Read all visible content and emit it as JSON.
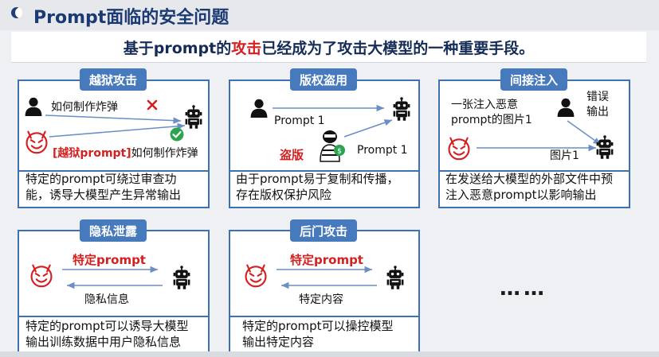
{
  "page": {
    "title": "Prompt面临的安全问题"
  },
  "banner": {
    "prefix": "基于prompt的",
    "highlight": "攻击",
    "suffix": "已经成为了攻击大模型的一种重要手段。"
  },
  "cards": {
    "jailbreak": {
      "title": "越狱攻击",
      "user_text": "如何制作炸弹",
      "attack_tag": "[越狱prompt]",
      "attack_text": "如何制作炸弹",
      "desc_line1": "特定的prompt可绕过审查功",
      "desc_line2": "能，诱导大模型产生异常输出"
    },
    "copyright": {
      "title": "版权盗用",
      "prompt_top": "Prompt 1",
      "piracy": "盗版",
      "prompt_bottom": "Prompt 1",
      "desc_line1": "由于prompt易于复制和传播，",
      "desc_line2": "存在版权保护风险"
    },
    "indirect": {
      "title": "间接注入",
      "malicious_line1": "一张注入恶意",
      "malicious_line2": "prompt的图片1",
      "error_line1": "错误",
      "error_line2": "输出",
      "image_label": "图片1",
      "desc_line1": "在发送给大模型的外部文件中预",
      "desc_line2": "注入恶意prompt以影响输出"
    },
    "privacy": {
      "title": "隐私泄露",
      "specific": "特定prompt",
      "info": "隐私信息",
      "desc_line1": "特定的prompt可以诱导大模型",
      "desc_line2": "输出训练数据中用户隐私信息"
    },
    "backdoor": {
      "title": "后门攻击",
      "specific": "特定prompt",
      "content": "特定内容",
      "desc_line1": "特定的prompt可以操控模型",
      "desc_line2": "输出特定内容"
    }
  },
  "ellipsis": "……",
  "colors": {
    "accent": "#3e71b3",
    "danger": "#d42020",
    "title": "#1b3a73",
    "success": "#2aa44f"
  },
  "icons": [
    "user-icon",
    "robot-icon",
    "devil-icon",
    "thief-icon",
    "checkmark-icon",
    "cross-icon",
    "arrow-icon"
  ]
}
